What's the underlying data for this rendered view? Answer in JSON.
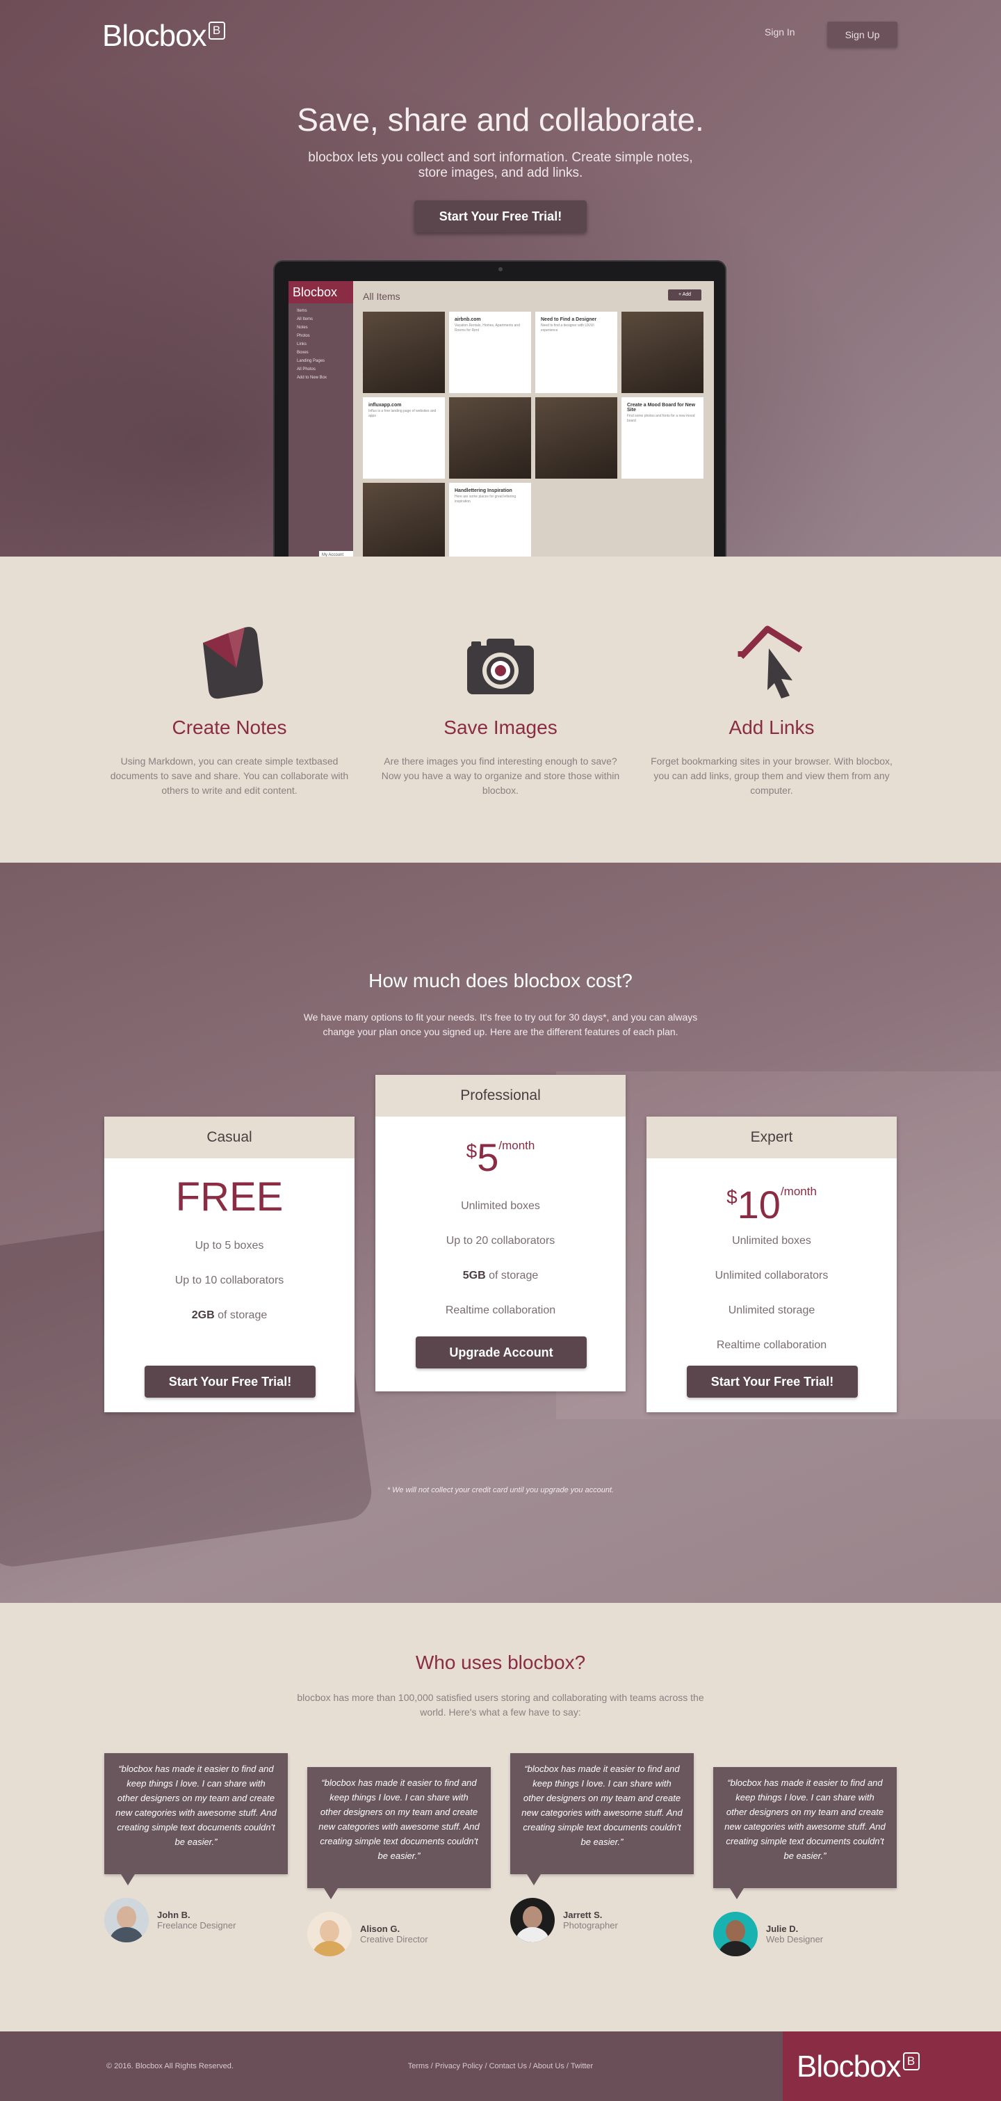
{
  "header": {
    "logo_text": "Blocbox",
    "logo_badge": "B",
    "signin_label": "Sign In",
    "signup_label": "Sign Up"
  },
  "hero": {
    "title": "Save, share and collaborate.",
    "subtitle": "blocbox lets you collect and sort information. Create simple notes, store images, and add links.",
    "cta_label": "Start Your Free Trial!"
  },
  "app_preview": {
    "logo_text": "Blocbox",
    "logo_badge": "B",
    "title": "All Items",
    "add_label": "+ Add",
    "account_label": "My Account",
    "nav_items": [
      "Items",
      "All Items",
      "Notes",
      "Photos",
      "Links",
      "Boxes",
      "Landing Pages",
      "All Photos",
      "Add to New Box"
    ],
    "tiles": [
      {
        "title": "",
        "text": "",
        "kind": "photo"
      },
      {
        "title": "airbnb.com",
        "text": "Vacation Rentals, Homes, Apartments and Rooms for Rent",
        "kind": "link"
      },
      {
        "title": "Need to Find a Designer",
        "text": "Need to find a designer with UX/UI experience",
        "kind": "note"
      },
      {
        "title": "",
        "text": "",
        "kind": "photo"
      },
      {
        "title": "influxapp.com",
        "text": "Influx is a free landing page of websites and apps",
        "kind": "link"
      },
      {
        "title": "",
        "text": "",
        "kind": "photo"
      },
      {
        "title": "",
        "text": "",
        "kind": "photo"
      },
      {
        "title": "Create a Mood Board for New Site",
        "text": "Find some photos and fonts for a new mood board",
        "kind": "note"
      },
      {
        "title": "",
        "text": "",
        "kind": "photo"
      },
      {
        "title": "Handlettering Inspiration",
        "text": "Here are some places for great lettering inspiration",
        "kind": "note"
      }
    ]
  },
  "features": [
    {
      "icon": "note-icon",
      "title": "Create Notes",
      "text": "Using Markdown, you can create simple textbased documents to save and share. You can collaborate with others to write and edit content."
    },
    {
      "icon": "camera-icon",
      "title": "Save Images",
      "text": "Are there images you find interesting enough to save? Now you have a way to organize and store those within blocbox."
    },
    {
      "icon": "link-cursor-icon",
      "title": "Add Links",
      "text": "Forget bookmarking sites in your browser. With blocbox, you can add links, group them and view them from any computer."
    }
  ],
  "pricing": {
    "title": "How much does blocbox cost?",
    "lead": "We have many options to fit your needs. It's free to try out for 30 days*, and you can always change your plan once you signed up. Here are the different features of each plan.",
    "plans": [
      {
        "name": "Casual",
        "price": "FREE",
        "currency": "",
        "period": "",
        "features": [
          "Up to 5 boxes",
          "Up to 10 collaborators",
          "of storage"
        ],
        "storage_bold": "2GB",
        "button": "Start Your Free Trial!"
      },
      {
        "name": "Professional",
        "price": "5",
        "currency": "$",
        "period": "/month",
        "features": [
          "Unlimited boxes",
          "Up to 20 collaborators",
          "of storage",
          "Realtime collaboration"
        ],
        "storage_bold": "5GB",
        "button": "Upgrade Account"
      },
      {
        "name": "Expert",
        "price": "10",
        "currency": "$",
        "period": "/month",
        "features": [
          "Unlimited boxes",
          "Unlimited collaborators",
          "Unlimited storage",
          "Realtime collaboration"
        ],
        "storage_bold": "",
        "button": "Start Your Free Trial!"
      }
    ],
    "disclaimer": "* We will not collect your credit card until you upgrade you account."
  },
  "testimonials": {
    "title": "Who uses blocbox?",
    "lead": "blocbox has more than 100,000 satisfied users storing and collaborating with teams across the world. Here's what a few have to say:",
    "quote": "“blocbox has made it easier to find and keep things I love. I can share with other designers on my team and create new categories with awesome stuff. And creating simple text documents couldn't be easier.”",
    "people": [
      {
        "name": "John B.",
        "role": "Freelance Designer"
      },
      {
        "name": "Alison G.",
        "role": "Creative Director"
      },
      {
        "name": "Jarrett S.",
        "role": "Photographer"
      },
      {
        "name": "Julie D.",
        "role": "Web Designer"
      }
    ]
  },
  "footer": {
    "copyright": "© 2016. Blocbox All Rights Reserved.",
    "links": [
      "Terms",
      "Privacy Policy",
      "Contact Us",
      "About Us",
      "Twitter"
    ],
    "logo_text": "Blocbox",
    "logo_badge": "B"
  },
  "colors": {
    "brand": "#8a2d44",
    "plum": "#6a4f58",
    "button": "#5c464e",
    "sand": "#e6ddd3"
  }
}
